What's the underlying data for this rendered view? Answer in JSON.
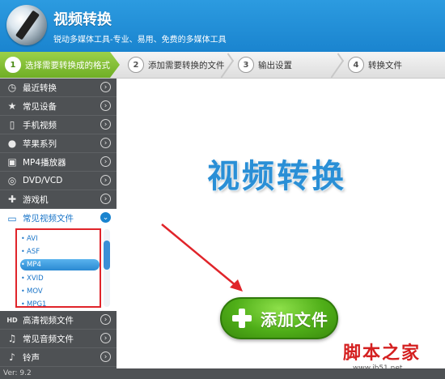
{
  "header": {
    "title": "视频转换",
    "subtitle": "锐动多媒体工具-专业、易用、免费的多媒体工具"
  },
  "steps": [
    {
      "num": "1",
      "label": "选择需要转换成的格式"
    },
    {
      "num": "2",
      "label": "添加需要转换的文件"
    },
    {
      "num": "3",
      "label": "输出设置"
    },
    {
      "num": "4",
      "label": "转换文件"
    }
  ],
  "sidebar": {
    "items": [
      {
        "label": "最近转换",
        "icon": "clock-icon"
      },
      {
        "label": "常见设备",
        "icon": "star-icon"
      },
      {
        "label": "手机视频",
        "icon": "phone-icon"
      },
      {
        "label": "苹果系列",
        "icon": "apple-icon"
      },
      {
        "label": "MP4播放器",
        "icon": "mp4-player-icon"
      },
      {
        "label": "DVD/VCD",
        "icon": "disc-icon"
      },
      {
        "label": "游戏机",
        "icon": "gamepad-icon"
      },
      {
        "label": "常见视频文件",
        "icon": "monitor-icon"
      },
      {
        "label": "高清视频文件",
        "icon": "hd-icon"
      },
      {
        "label": "常见音频文件",
        "icon": "music-note-icon"
      },
      {
        "label": "铃声",
        "icon": "bell-icon"
      }
    ],
    "formats": [
      "AVI",
      "ASF",
      "MP4",
      "XVID",
      "MOV",
      "MPG1"
    ],
    "selected_format": "MP4"
  },
  "main": {
    "title": "视频转换",
    "add_button_label": "添加文件"
  },
  "watermark": {
    "text": "脚本之家",
    "url": "www.jb51.net"
  },
  "status": {
    "version": "Ver: 9.2"
  },
  "colors": {
    "header": "#1a84cf",
    "step_active": "#6fae25",
    "sidebar": "#4e5154",
    "accent_blue": "#2a8fd6",
    "button_green": "#4fae18",
    "highlight_red": "#e0242a"
  }
}
